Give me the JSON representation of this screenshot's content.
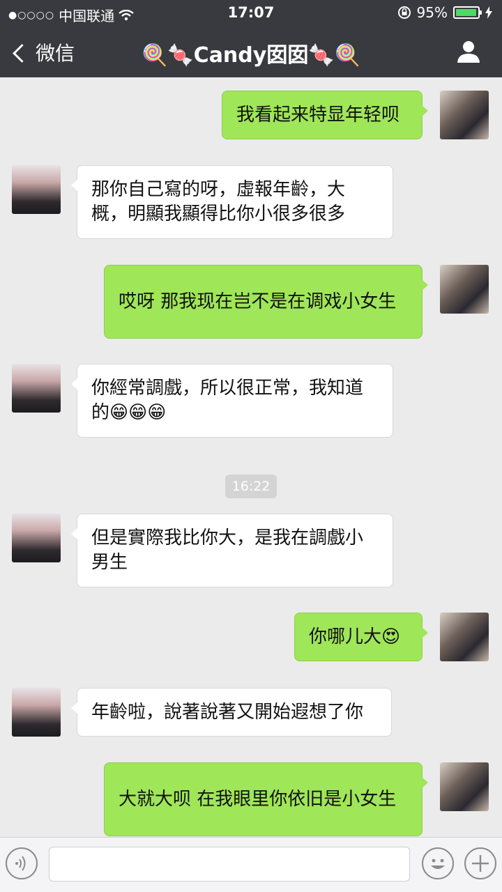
{
  "status_bar": {
    "carrier": "中国联通",
    "time": "17:07",
    "battery": "95%",
    "battery_level": 0.95
  },
  "header": {
    "back_label": "微信",
    "title": "🍭🍬Candy囡囡🍬🍭"
  },
  "messages": [
    {
      "sender": "me",
      "text": "我看起来特显年轻呗"
    },
    {
      "sender": "her",
      "text": "那你自己寫的呀，虛報年齡，大概，明顯我顯得比你小很多很多"
    },
    {
      "sender": "me",
      "text": "哎呀 那我现在岂不是在调戏小女生"
    },
    {
      "sender": "her",
      "text": "你經常調戲，所以很正常，我知道的😁😁😁"
    },
    {
      "sender": "her",
      "text": "但是實際我比你大，是我在調戲小男生"
    },
    {
      "sender": "me",
      "text": "你哪儿大😍"
    },
    {
      "sender": "her",
      "text": "年齡啦，說著說著又開始遐想了你"
    },
    {
      "sender": "me",
      "text": "大就大呗 在我眼里你依旧是小女生"
    }
  ],
  "timestamp": "16:22",
  "input_bar": {
    "text_value": ""
  },
  "icons": {
    "voice": "voice-icon",
    "emoji": "emoji-icon",
    "plus": "plus-icon",
    "person": "person-icon"
  },
  "colors": {
    "my_bubble": "#9fe658",
    "her_bubble": "#ffffff",
    "header_bg": "#393a3f"
  }
}
